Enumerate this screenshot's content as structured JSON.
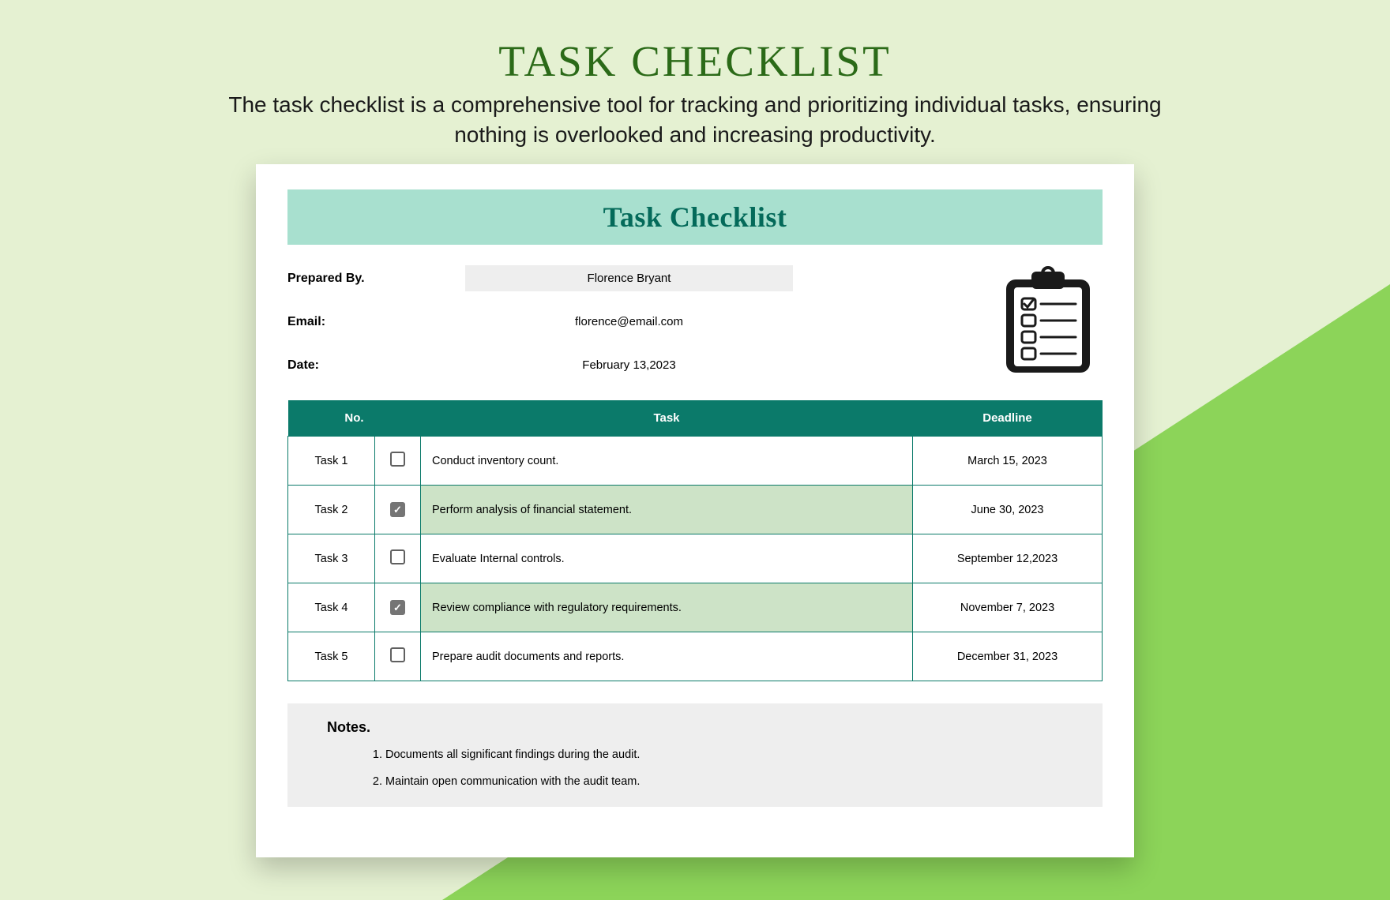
{
  "page": {
    "title": "TASK CHECKLIST",
    "subtitle": "The task checklist is a comprehensive tool for tracking and prioritizing individual tasks, ensuring nothing is overlooked and increasing productivity."
  },
  "doc": {
    "title": "Task Checklist",
    "meta": {
      "prepared_by_label": "Prepared By.",
      "prepared_by_value": "Florence Bryant",
      "email_label": "Email:",
      "email_value": "florence@email.com",
      "date_label": "Date:",
      "date_value": "February 13,2023"
    },
    "table": {
      "headers": {
        "no": "No.",
        "task": "Task",
        "deadline": "Deadline"
      },
      "rows": [
        {
          "no": "Task 1",
          "task": "Conduct inventory count.",
          "deadline": "March 15, 2023",
          "checked": false
        },
        {
          "no": "Task 2",
          "task": "Perform analysis of financial statement.",
          "deadline": "June 30, 2023",
          "checked": true
        },
        {
          "no": "Task 3",
          "task": "Evaluate Internal controls.",
          "deadline": "September 12,2023",
          "checked": false
        },
        {
          "no": "Task 4",
          "task": "Review compliance with regulatory requirements.",
          "deadline": "November 7, 2023",
          "checked": true
        },
        {
          "no": "Task 5",
          "task": "Prepare audit documents and reports.",
          "deadline": "December 31, 2023",
          "checked": false
        }
      ]
    },
    "notes": {
      "heading": "Notes.",
      "items": [
        "Documents all significant findings during the audit.",
        "Maintain open communication with the audit team."
      ]
    }
  }
}
